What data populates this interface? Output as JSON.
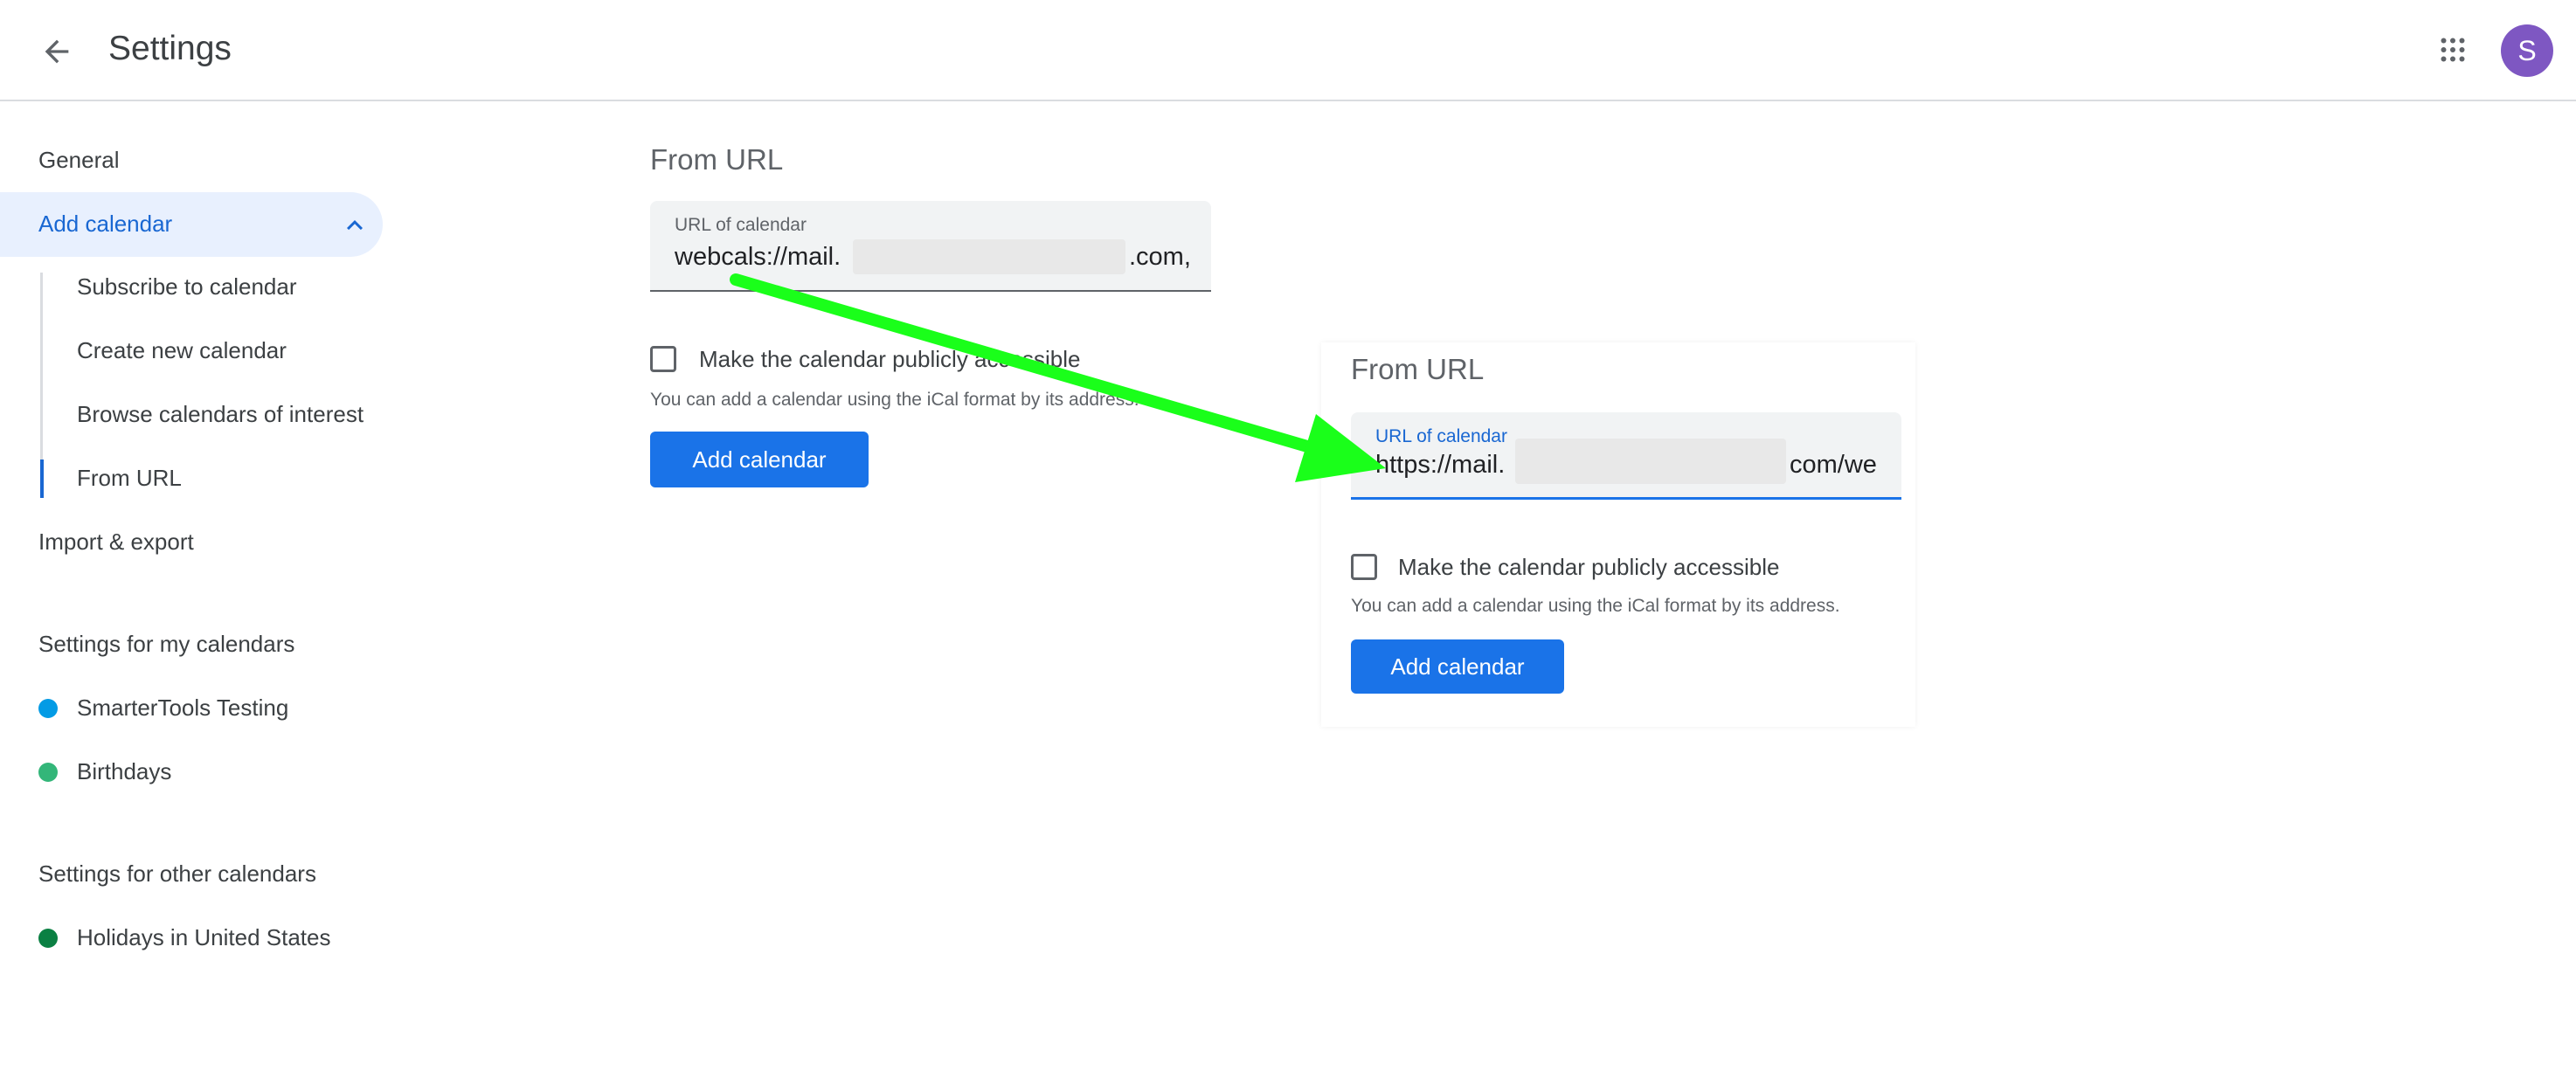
{
  "header": {
    "title": "Settings",
    "avatar_letter": "S"
  },
  "sidebar": {
    "general": "General",
    "add_calendar": "Add calendar",
    "sub_items": [
      "Subscribe to calendar",
      "Create new calendar",
      "Browse calendars of interest",
      "From URL"
    ],
    "import_export": "Import & export",
    "my_calendars_heading": "Settings for my calendars",
    "my_calendars": [
      {
        "name": "SmarterTools Testing",
        "color": "#039be5"
      },
      {
        "name": "Birthdays",
        "color": "#33b679"
      }
    ],
    "other_calendars_heading": "Settings for other calendars",
    "other_calendars": [
      {
        "name": "Holidays in United States",
        "color": "#0b8043"
      }
    ]
  },
  "main": {
    "title": "From URL",
    "url_label": "URL of calendar",
    "url_prefix": "webcals://mail.",
    "url_suffix": ".com,",
    "public_checkbox_label": "Make the calendar publicly accessible",
    "helper_text": "You can add a calendar using the iCal format by its address.",
    "add_button": "Add calendar"
  },
  "zoom": {
    "title": "From URL",
    "url_label": "URL of calendar",
    "url_prefix": "https://mail.",
    "url_suffix": "com/we",
    "public_checkbox_label": "Make the calendar publicly accessible",
    "helper_text": "You can add a calendar using the iCal format by its address.",
    "add_button": "Add calendar"
  },
  "colors": {
    "accent": "#1a73e8",
    "arrow": "#1aff1a"
  }
}
